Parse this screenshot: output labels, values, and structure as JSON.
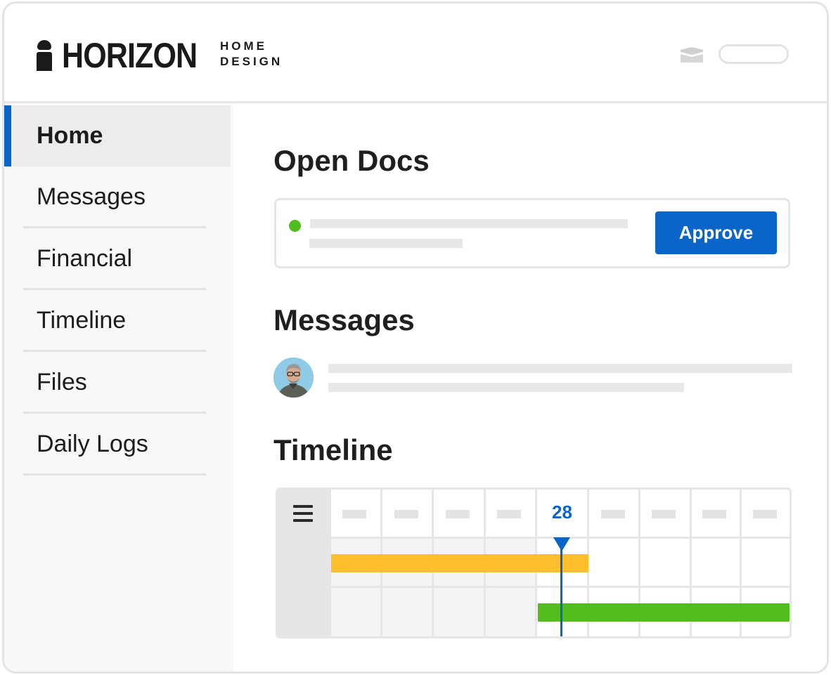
{
  "brand": {
    "name": "HORIZON",
    "tagline_line1": "HOME",
    "tagline_line2": "DESIGN"
  },
  "header": {
    "icons": [
      "mail-icon"
    ],
    "search_pill_value": ""
  },
  "sidebar": {
    "items": [
      {
        "label": "Home",
        "active": true
      },
      {
        "label": "Messages",
        "active": false
      },
      {
        "label": "Financial",
        "active": false
      },
      {
        "label": "Timeline",
        "active": false
      },
      {
        "label": "Files",
        "active": false
      },
      {
        "label": "Daily Logs",
        "active": false
      }
    ]
  },
  "main": {
    "open_docs": {
      "title": "Open Docs",
      "status_color": "#4fbd1c",
      "approve_label": "Approve"
    },
    "messages": {
      "title": "Messages",
      "avatar_icon": "user-avatar"
    },
    "timeline": {
      "title": "Timeline",
      "menu_icon": "hamburger-menu-icon",
      "today_label": "28",
      "bars": [
        {
          "color": "#ffbe2e"
        },
        {
          "color": "#52bd1c"
        }
      ]
    }
  },
  "colors": {
    "accent": "#0b64c8",
    "success": "#4fbd1c",
    "warning": "#ffbe2e"
  }
}
